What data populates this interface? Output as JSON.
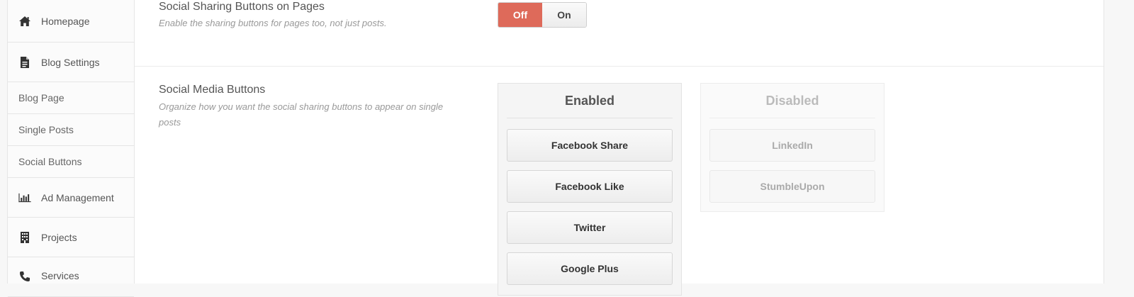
{
  "sidebar": {
    "items": [
      {
        "label": "Homepage",
        "icon": "home-icon"
      },
      {
        "label": "Blog Settings",
        "icon": "document-icon"
      },
      {
        "label": "Blog Page"
      },
      {
        "label": "Single Posts"
      },
      {
        "label": "Social Buttons"
      },
      {
        "label": "Ad Management",
        "icon": "bar-chart-icon"
      },
      {
        "label": "Projects",
        "icon": "building-icon"
      },
      {
        "label": "Services",
        "icon": "phone-icon"
      }
    ]
  },
  "options": {
    "sharing_pages": {
      "title": "Social Sharing Buttons on Pages",
      "description": "Enable the sharing buttons for pages too, not just posts.",
      "toggle": {
        "off_label": "Off",
        "on_label": "On",
        "selected": "Off",
        "selected_color": "#de6a5a"
      }
    },
    "media_buttons": {
      "title": "Social Media Buttons",
      "description": "Organize how you want the social sharing buttons to appear on single posts",
      "enabled": {
        "heading": "Enabled",
        "items": [
          "Facebook Share",
          "Facebook Like",
          "Twitter",
          "Google Plus"
        ]
      },
      "disabled": {
        "heading": "Disabled",
        "items": [
          "LinkedIn",
          "StumbleUpon"
        ]
      }
    }
  }
}
